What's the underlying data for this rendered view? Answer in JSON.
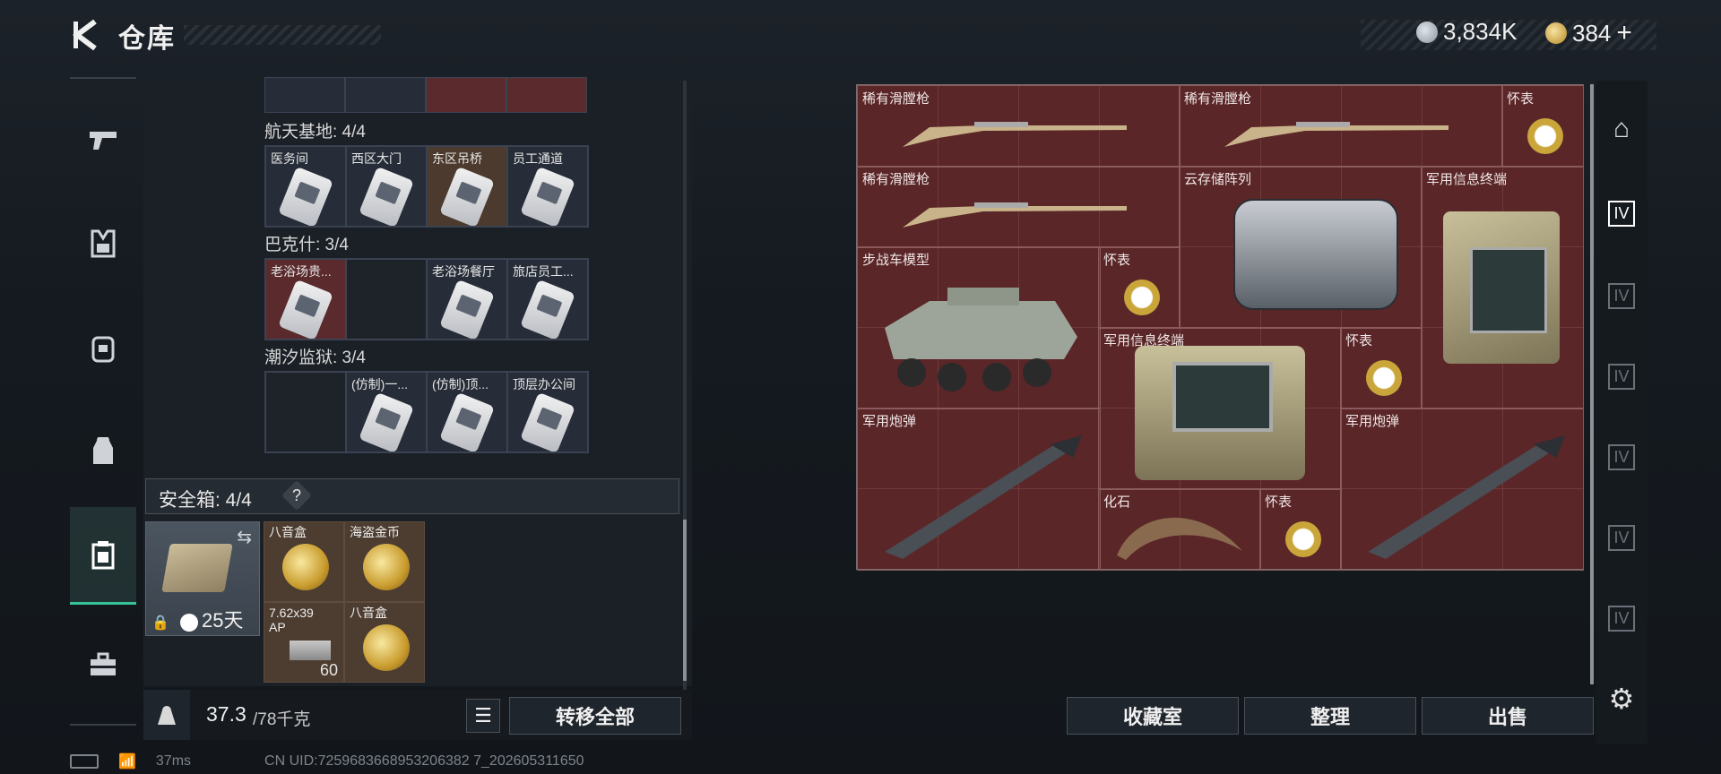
{
  "header": {
    "title": "仓库",
    "currency1": {
      "icon": "silver-coin-icon",
      "value": "3,834K"
    },
    "currency2": {
      "icon": "gold-coin-icon",
      "value": "384"
    },
    "add_symbol": "+"
  },
  "leftnav": {
    "items": [
      {
        "icon": "pistol-icon"
      },
      {
        "icon": "vest-icon"
      },
      {
        "icon": "backpack-icon"
      },
      {
        "icon": "chest-rig-icon"
      },
      {
        "icon": "safe-case-icon",
        "active": true
      },
      {
        "icon": "toolbox-icon"
      }
    ]
  },
  "keycards": {
    "sections": [
      {
        "title": "航天基地: 4/4",
        "cells": [
          "医务间",
          "西区大门",
          "东区吊桥",
          "员工通道"
        ]
      },
      {
        "title": "巴克什: 3/4",
        "cells": [
          "老浴场贵...",
          "",
          "老浴场餐厅",
          "旅店员工..."
        ]
      },
      {
        "title": "潮汐监狱: 3/4",
        "cells": [
          "",
          "(仿制)一...",
          "(仿制)顶...",
          "顶层办公间"
        ]
      }
    ]
  },
  "safe_box": {
    "title": "安全箱: 4/4",
    "help": "?",
    "days": "25天",
    "items": [
      {
        "label": "八音盒"
      },
      {
        "label": "海盗金币"
      },
      {
        "label": "7.62x39 AP",
        "count": "60"
      },
      {
        "label": "八音盒"
      }
    ]
  },
  "weight": {
    "current": "37.3",
    "max": "/78千克"
  },
  "buttons": {
    "transfer_all": "转移全部",
    "collection_room": "收藏室",
    "organize": "整理",
    "sell": "出售"
  },
  "stash_items": [
    {
      "label": "稀有滑膛枪",
      "icon": "musket-icon"
    },
    {
      "label": "稀有滑膛枪",
      "icon": "musket-icon"
    },
    {
      "label": "怀表",
      "icon": "pocket-watch-icon"
    },
    {
      "label": "稀有滑膛枪",
      "icon": "musket-icon"
    },
    {
      "label": "云存储阵列",
      "icon": "storage-array-icon"
    },
    {
      "label": "军用信息终端",
      "icon": "terminal-icon"
    },
    {
      "label": "步战车模型",
      "icon": "ifv-model-icon"
    },
    {
      "label": "怀表",
      "icon": "pocket-watch-icon"
    },
    {
      "label": "军用信息终端",
      "icon": "terminal-icon"
    },
    {
      "label": "怀表",
      "icon": "pocket-watch-icon"
    },
    {
      "label": "军用炮弹",
      "icon": "missile-icon"
    },
    {
      "label": "军用炮弹",
      "icon": "missile-icon"
    },
    {
      "label": "化石",
      "icon": "fossil-icon"
    },
    {
      "label": "怀表",
      "icon": "pocket-watch-icon"
    }
  ],
  "footer": {
    "ping": "37ms",
    "uid": "CN UID:7259683668953206382 7_202605311650"
  },
  "colors": {
    "accent": "#35c49a",
    "stash_bg": "#5a2628",
    "keycard_red": "#5a2a2d"
  }
}
